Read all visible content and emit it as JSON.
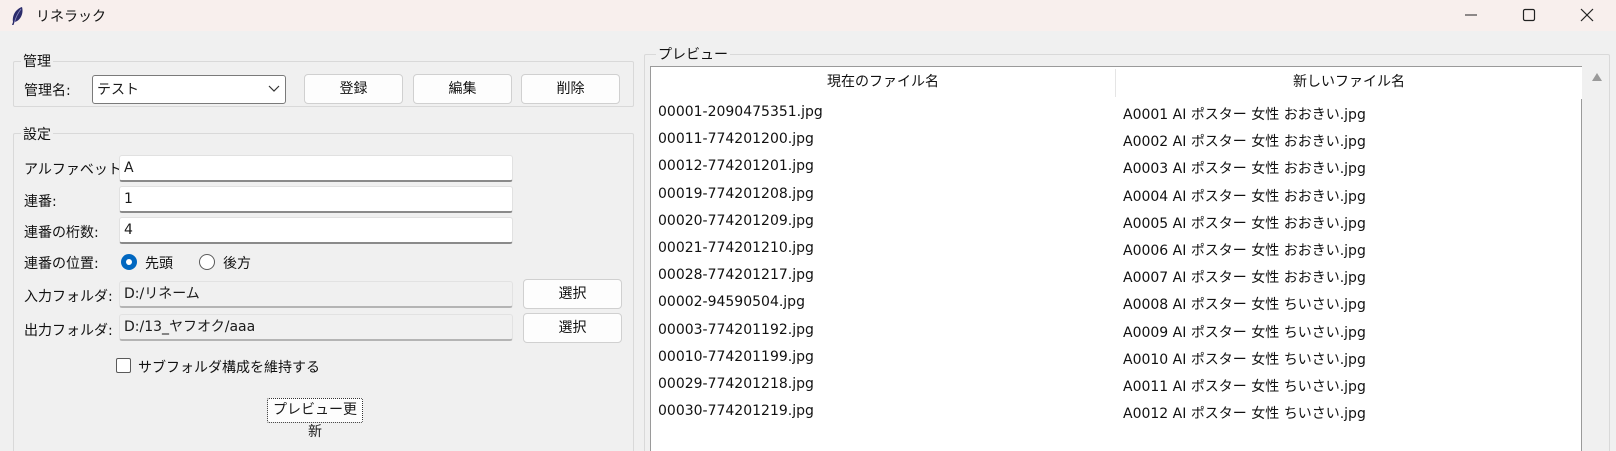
{
  "window": {
    "title": "リネラック",
    "controls": {
      "minimize": "minimize",
      "maximize": "maximize",
      "close": "close"
    }
  },
  "manage": {
    "group_label": "管理",
    "name_label": "管理名:",
    "name_value": "テスト",
    "register": "登録",
    "edit": "編集",
    "delete": "削除"
  },
  "settings": {
    "group_label": "設定",
    "alphabet_label": "アルファベット:",
    "alphabet_value": "A",
    "serial_label": "連番:",
    "serial_value": "1",
    "digits_label": "連番の桁数:",
    "digits_value": "4",
    "position_label": "連番の位置:",
    "position_options": [
      "先頭",
      "後方"
    ],
    "position_selected": "先頭",
    "input_label": "入力フォルダ:",
    "input_value": "D:/リネーム",
    "input_select": "選択",
    "output_label": "出力フォルダ:",
    "output_value": "D:/13_ヤフオク/aaa",
    "output_select": "選択",
    "keep_structure_label": "サブフォルダ構成を維持する",
    "keep_structure_checked": false,
    "preview_update": "プレビュー更新"
  },
  "preview": {
    "group_label": "プレビュー",
    "columns": [
      "現在のファイル名",
      "新しいファイル名"
    ],
    "rows": [
      [
        "00001-2090475351.jpg",
        "A0001 AI ポスター 女性 おおきい.jpg"
      ],
      [
        "00011-774201200.jpg",
        "A0002 AI ポスター 女性 おおきい.jpg"
      ],
      [
        "00012-774201201.jpg",
        "A0003 AI ポスター 女性 おおきい.jpg"
      ],
      [
        "00019-774201208.jpg",
        "A0004 AI ポスター 女性 おおきい.jpg"
      ],
      [
        "00020-774201209.jpg",
        "A0005 AI ポスター 女性 おおきい.jpg"
      ],
      [
        "00021-774201210.jpg",
        "A0006 AI ポスター 女性 おおきい.jpg"
      ],
      [
        "00028-774201217.jpg",
        "A0007 AI ポスター 女性 おおきい.jpg"
      ],
      [
        "00002-94590504.jpg",
        "A0008 AI ポスター 女性 ちいさい.jpg"
      ],
      [
        "00003-774201192.jpg",
        "A0009 AI ポスター 女性 ちいさい.jpg"
      ],
      [
        "00010-774201199.jpg",
        "A0010 AI ポスター 女性 ちいさい.jpg"
      ],
      [
        "00029-774201218.jpg",
        "A0011 AI ポスター 女性 ちいさい.jpg"
      ],
      [
        "00030-774201219.jpg",
        "A0012 AI ポスター 女性 ちいさい.jpg"
      ]
    ]
  },
  "colors": {
    "accent": "#0067c0",
    "titlebar": "#f8efed",
    "background": "#f0f0f0"
  }
}
